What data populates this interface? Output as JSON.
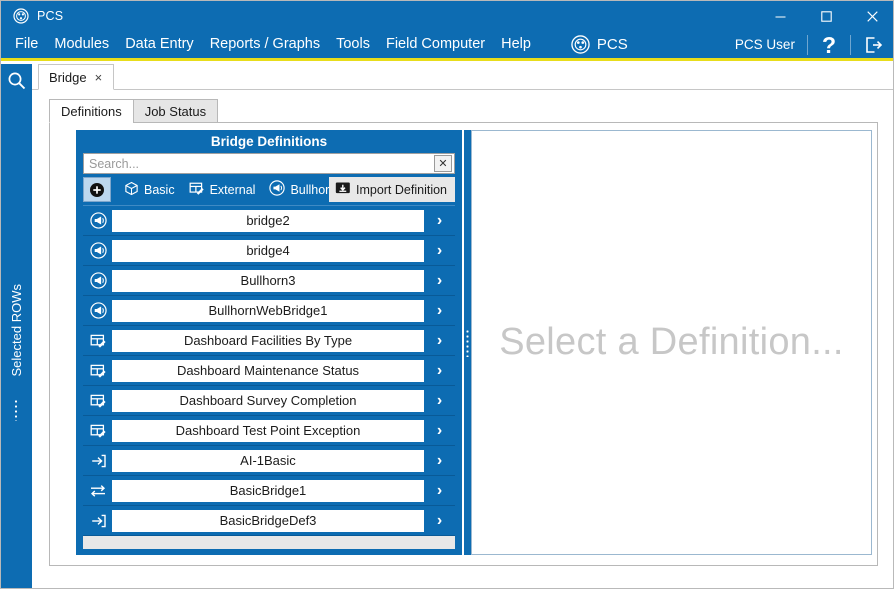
{
  "window": {
    "title": "PCS",
    "logo_icon": "pcs-logo-icon",
    "minimize_icon": "minimize-icon",
    "maximize_icon": "maximize-icon",
    "close_icon": "close-icon"
  },
  "menubar": {
    "items": [
      {
        "label": "File"
      },
      {
        "label": "Modules"
      },
      {
        "label": "Data Entry"
      },
      {
        "label": "Reports / Graphs"
      },
      {
        "label": "Tools"
      },
      {
        "label": "Field Computer"
      },
      {
        "label": "Help"
      }
    ],
    "brand": {
      "label": "PCS",
      "icon": "pcs-brand-icon"
    },
    "user": "PCS User",
    "help_label": "?",
    "logout_icon": "logout-icon"
  },
  "rail": {
    "search_icon": "search-icon",
    "label": "Selected ROWs"
  },
  "doc_tabs": [
    {
      "label": "Bridge",
      "close": "×",
      "active": true
    }
  ],
  "sub_tabs": [
    {
      "label": "Definitions",
      "active": true
    },
    {
      "label": "Job Status",
      "active": false
    }
  ],
  "definitions_panel": {
    "title": "Bridge Definitions",
    "search": {
      "value": "",
      "placeholder": "Search...",
      "clear_label": "✕",
      "clear_icon": "clear-search-icon"
    },
    "toolbar": {
      "add_label": "",
      "add_icon": "add-circle-icon",
      "buttons": [
        {
          "label": "Basic",
          "icon": "cube-icon"
        },
        {
          "label": "External",
          "icon": "table-edit-icon"
        },
        {
          "label": "Bullhorn",
          "icon": "bullhorn-icon"
        }
      ],
      "import_label": "Import Definition",
      "import_icon": "import-definition-icon"
    },
    "rows": [
      {
        "name": "bridge2",
        "icon": "bullhorn-icon"
      },
      {
        "name": "bridge4",
        "icon": "bullhorn-icon"
      },
      {
        "name": "Bullhorn3",
        "icon": "bullhorn-icon"
      },
      {
        "name": "BullhornWebBridge1",
        "icon": "bullhorn-icon"
      },
      {
        "name": "Dashboard Facilities By Type",
        "icon": "table-edit-icon"
      },
      {
        "name": "Dashboard Maintenance Status",
        "icon": "table-edit-icon"
      },
      {
        "name": "Dashboard Survey Completion",
        "icon": "table-edit-icon"
      },
      {
        "name": "Dashboard Test Point Exception",
        "icon": "table-edit-icon"
      },
      {
        "name": "AI-1Basic",
        "icon": "import-arrow-icon"
      },
      {
        "name": "BasicBridge1",
        "icon": "exchange-arrows-icon"
      },
      {
        "name": "BasicBridgeDef3",
        "icon": "import-arrow-icon"
      }
    ],
    "row_chevron": "›"
  },
  "detail_pane": {
    "placeholder": "Select a Definition..."
  },
  "colors": {
    "brand_blue": "#0d6cb2",
    "accent_yellow": "#e8dd1b",
    "row_white": "#ffffff",
    "placeholder_gray": "#c7c7c7",
    "toolbar_light": "#e8e8e8"
  }
}
